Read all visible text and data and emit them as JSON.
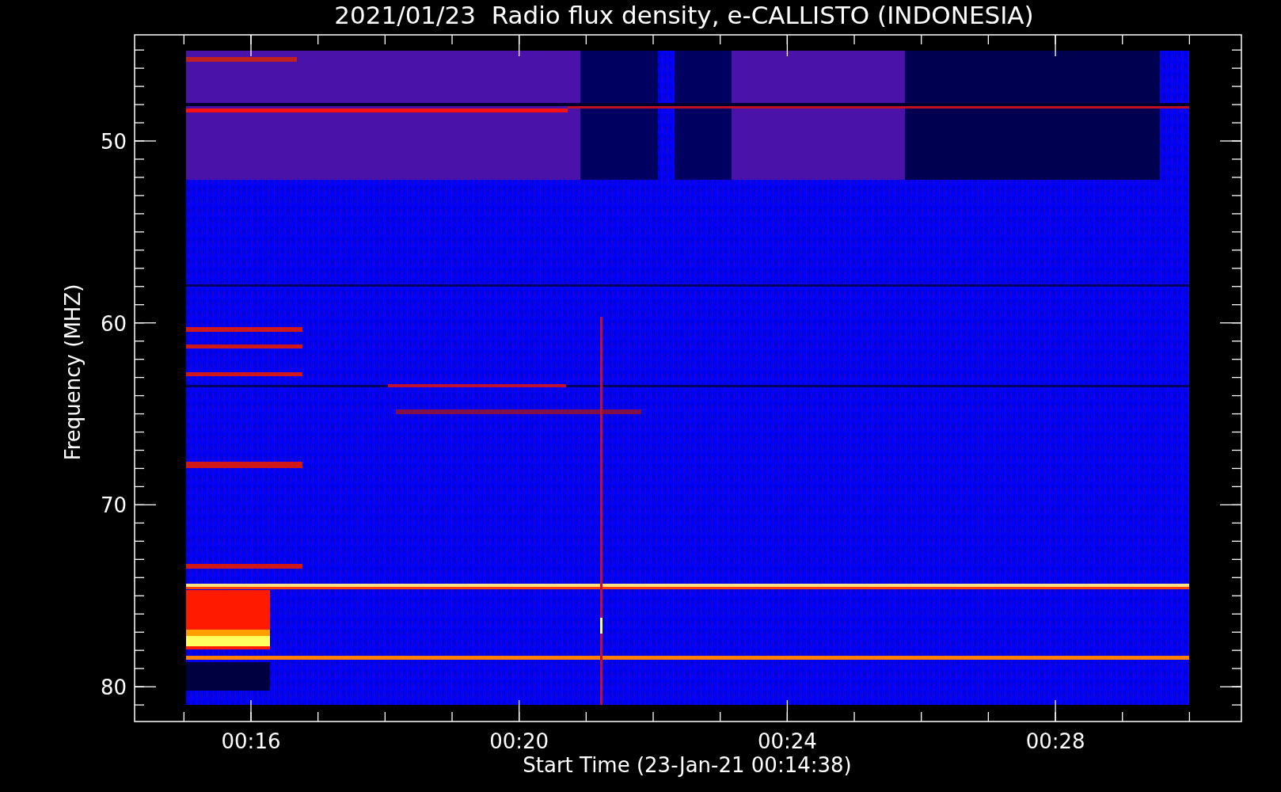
{
  "chart": {
    "title": "2021/01/23  Radio flux density, e-CALLISTO (INDONESIA)",
    "ylabel": "Frequency (MHZ)",
    "xlabel": "Start Time (23-Jan-21 00:14:38)",
    "yticks": [
      "50",
      "60",
      "70",
      "80"
    ],
    "xticks": [
      "00:16",
      "00:20",
      "00:24",
      "00:28"
    ]
  }
}
